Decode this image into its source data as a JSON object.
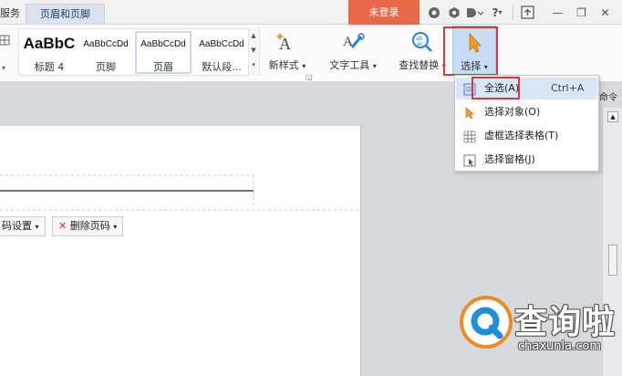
{
  "topbar": {
    "services_tab": "服务",
    "header_footer_tab": "页眉和页脚",
    "login_button": "未登录",
    "help_label": "?",
    "minimize_label": "—",
    "restore_label": "❐",
    "close_label": "✕"
  },
  "ribbon": {
    "styles": [
      {
        "preview": "AaBbC",
        "name": "标题 4"
      },
      {
        "preview": "AaBbCcDd",
        "name": "页脚"
      },
      {
        "preview": "AaBbCcDd",
        "name": "页眉"
      },
      {
        "preview": "AaBbCcDd",
        "name": "默认段..."
      }
    ],
    "new_style": "新样式",
    "text_tools": "文字工具",
    "find_replace": "查找替换",
    "select": "选择"
  },
  "select_menu": {
    "items": [
      {
        "label": "全选(A)",
        "shortcut": "Ctrl+A"
      },
      {
        "label": "选择对象(O)"
      },
      {
        "label": "虚框选择表格(T)"
      },
      {
        "label": "选择窗格(J)"
      }
    ]
  },
  "side_label": "命令",
  "page_toolbar": {
    "page_number_settings": "码设置",
    "delete_page_number": "删除页码"
  },
  "watermark": {
    "title": "查询啦",
    "url": "chaxunla.com"
  },
  "colors": {
    "login_bg": "#e8694a",
    "select_highlight": "#c8dcf3",
    "callout_red": "#e2343c",
    "watermark_orange": "#f08b23"
  }
}
